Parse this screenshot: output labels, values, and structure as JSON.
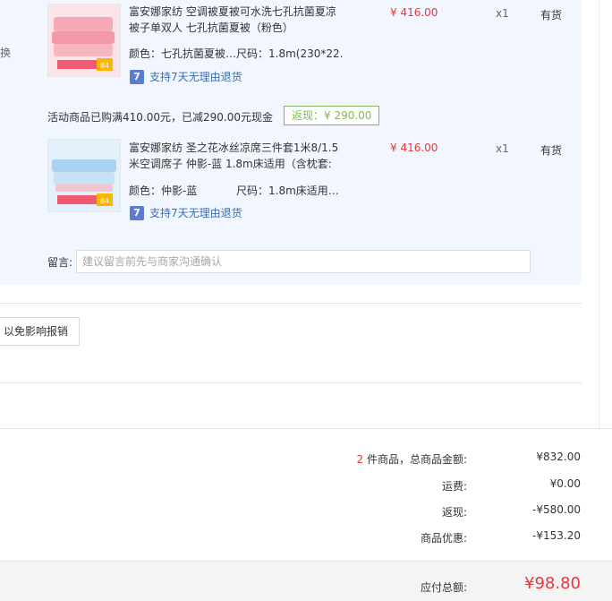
{
  "left_edge": {
    "char": "换"
  },
  "items": [
    {
      "title_line1": "富安娜家纺 空调被夏被可水洗七孔抗菌夏凉",
      "title_line2": "被子单双人 七孔抗菌夏被（粉色）",
      "color_label": "颜色：七孔抗菌夏被…",
      "size_label": "尺码：1.8m(230*22…",
      "price": "¥ 416.00",
      "qty": "x1",
      "stock": "有货",
      "return_policy": "支持7天无理由退货",
      "return_icon": "7",
      "thumb_badge": "84"
    },
    {
      "title_line1": "富安娜家纺 圣之花冰丝凉席三件套1米8/1.5",
      "title_line2": "米空调席子 仲影-蓝 1.8m床适用（含枕套:",
      "color_label": "颜色：仲影-蓝",
      "size_label": "尺码：1.8m床适用…",
      "price": "¥ 416.00",
      "qty": "x1",
      "stock": "有货",
      "return_policy": "支持7天无理由退货",
      "return_icon": "7",
      "thumb_badge": "84"
    }
  ],
  "promo": {
    "text": "活动商品已购满410.00元，已减290.00元现金",
    "rebate": "返现：¥ 290.00"
  },
  "remark": {
    "label": "留言:",
    "placeholder": "建议留言前先与商家沟通确认"
  },
  "notice_button": "以免影响报销",
  "summary": {
    "count": "2",
    "count_suffix": " 件商品，总商品金额:",
    "goods_total": "¥832.00",
    "shipping_label": "运费:",
    "shipping": "¥0.00",
    "cashback_label": "返现:",
    "cashback": "-¥580.00",
    "discount_label": "商品优惠:",
    "discount": "-¥153.20",
    "payable_label": "应付总额:",
    "payable": "¥98.80"
  },
  "colors": {
    "price_red": "#e4393c",
    "rebate_green": "#7fba59",
    "link_blue": "#3a6cb0",
    "panel_bg": "#f2f7ff"
  }
}
